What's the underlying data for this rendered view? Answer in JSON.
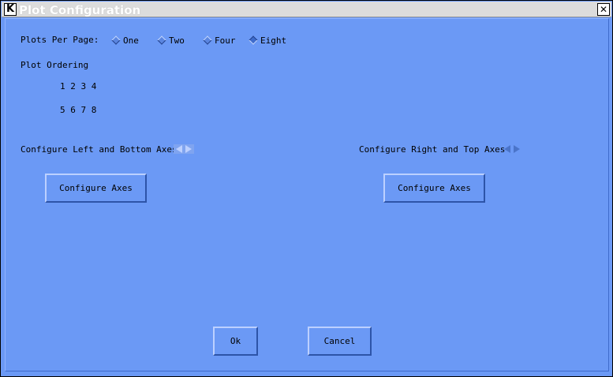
{
  "window": {
    "title": "Plot Configuration",
    "app_icon": "K",
    "close_glyph": "✕"
  },
  "plots_per_page": {
    "label": "Plots Per Page:",
    "options": [
      {
        "label": "One",
        "selected": false
      },
      {
        "label": "Two",
        "selected": false
      },
      {
        "label": "Four",
        "selected": false
      },
      {
        "label": "Eight",
        "selected": true
      }
    ]
  },
  "plot_ordering": {
    "label": "Plot Ordering",
    "row1": "1 2 3 4",
    "row2": "5 6 7 8"
  },
  "left_bottom": {
    "label": "Configure Left and Bottom Axes",
    "button": "Configure Axes"
  },
  "right_top": {
    "label": "Configure Right and Top Axes",
    "button": "Configure Axes"
  },
  "footer": {
    "ok": "Ok",
    "cancel": "Cancel"
  },
  "icons": {
    "radio": "diamond-radio-icon",
    "spinner": "left-right-arrows-icon"
  },
  "colors": {
    "background": "#6b99f5",
    "titlebar": "#dcdcdc"
  }
}
